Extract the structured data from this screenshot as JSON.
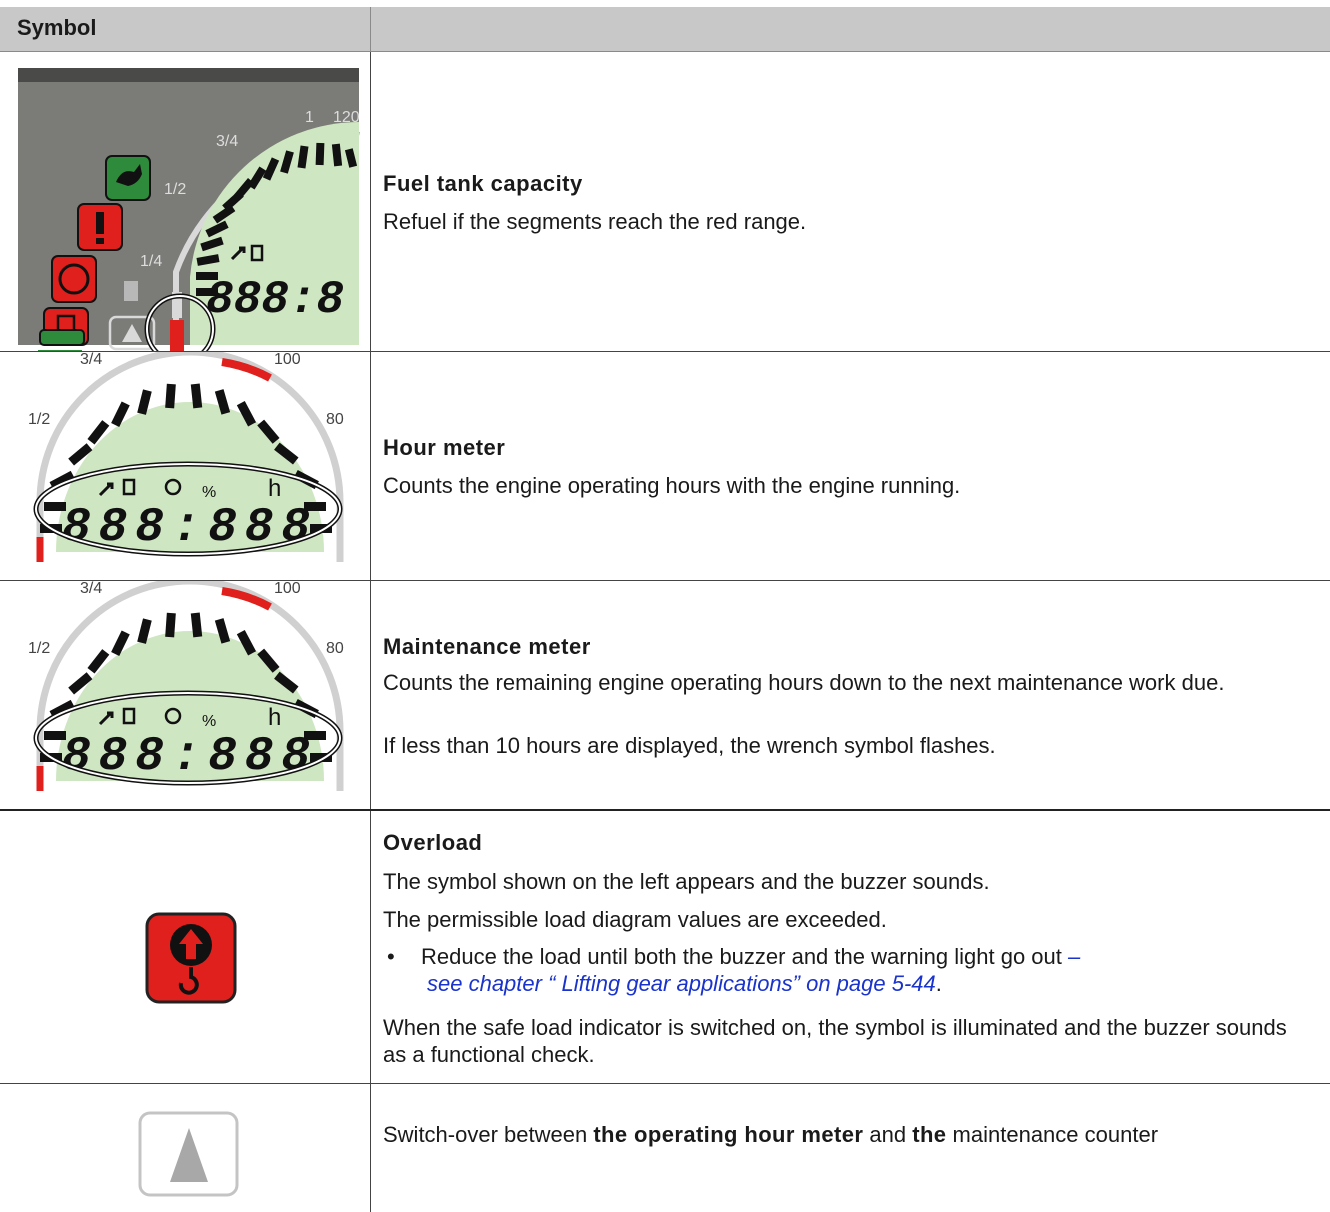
{
  "table": {
    "header": {
      "symbol_col": "Symbol",
      "description_col": ""
    },
    "rows": [
      {
        "id": "fuel",
        "title": "Fuel tank capacity",
        "text": "Refuel if the segments reach the red range.",
        "image_labels": {
          "scale_1": "1",
          "scale_34": "3/4",
          "scale_12": "1/2",
          "scale_14": "1/4",
          "temp_120": "120"
        }
      },
      {
        "id": "hour",
        "title": "Hour meter",
        "text": "Counts the engine operating hours with the engine running.",
        "image_labels": {
          "scale_34": "3/4",
          "scale_12": "1/2",
          "temp_100": "100",
          "temp_80": "80",
          "percent": "%",
          "hour": "h"
        }
      },
      {
        "id": "maint",
        "title": "Maintenance meter",
        "line1": "Counts the remaining engine operating hours down to the next maintenance work due.",
        "line2": "If less than 10 hours are displayed, the wrench symbol flashes.",
        "image_labels": {
          "scale_34": "3/4",
          "scale_12": "1/2",
          "temp_100": "100",
          "temp_80": "80",
          "percent": "%",
          "hour": "h"
        }
      },
      {
        "id": "overload",
        "title": "Overload",
        "p1": "The symbol shown on the left appears and the buzzer sounds.",
        "p2": "The permissible load diagram values are exceeded.",
        "bullet_mark": "•",
        "bullet_text": "Reduce the load until both the buzzer and the warning light go out",
        "link_dash": "–",
        "link_text": "see chapter “ Lifting gear applications” on page 5-44",
        "link_period": ".",
        "p3": "When the safe load indicator is switched on, the symbol is illuminated and the buzzer sounds as a functional check."
      },
      {
        "id": "switch",
        "part1": "Switch-over between ",
        "part2": "the operating hour meter",
        "part3": " and ",
        "part4": "the",
        "part5": " maintenance counter"
      }
    ]
  },
  "lcd_digits": "888:888",
  "lcd_digits_short": "888:8",
  "colors": {
    "lcd_green": "#cfe6c2",
    "warning_red": "#e0201c",
    "panel_grey": "#7b7b78",
    "indicator_green": "#2e8b3c"
  }
}
